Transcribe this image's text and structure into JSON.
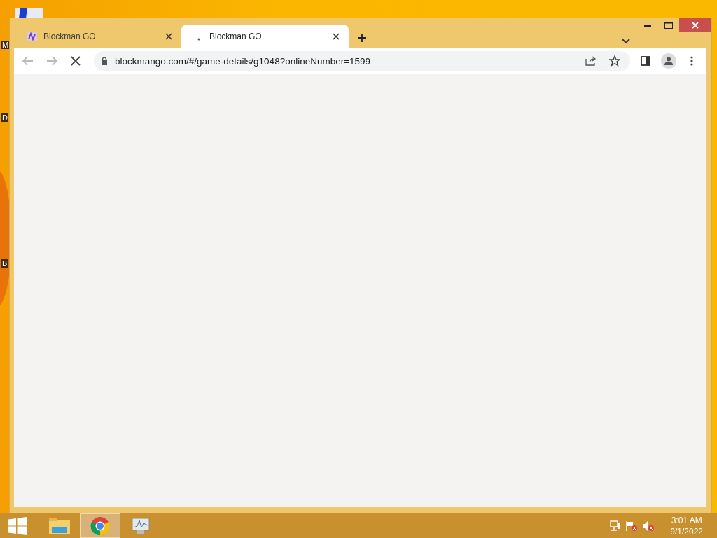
{
  "desktop": {
    "icon_labels": [
      "M",
      "D",
      "B"
    ]
  },
  "browser": {
    "tabs": [
      {
        "title": "Blockman GO",
        "selected": false,
        "loading": false
      },
      {
        "title": "Blockman GO",
        "selected": true,
        "loading": true
      }
    ],
    "address": "blockmango.com/#/game-details/g1048?onlineNumber=1599",
    "loading": true
  },
  "taskbar": {
    "apps": [
      {
        "kind": "explorer",
        "selected": false
      },
      {
        "kind": "chrome",
        "selected": true
      },
      {
        "kind": "monitor",
        "selected": false
      }
    ],
    "time": "3:01 AM",
    "date": "9/1/2022"
  }
}
